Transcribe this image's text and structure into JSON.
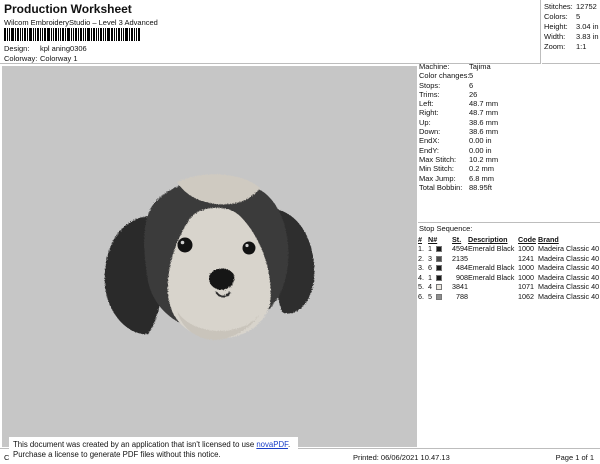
{
  "header": {
    "title": "Production Worksheet",
    "subtitle": "Wilcom EmbroideryStudio – Level 3 Advanced",
    "design_label": "Design:",
    "design_value": "kpl aning0306",
    "colorway_label": "Colorway:",
    "colorway_value": "Colorway 1"
  },
  "summary": [
    {
      "label": "Stitches:",
      "value": "12752"
    },
    {
      "label": "Colors:",
      "value": "5"
    },
    {
      "label": "Height:",
      "value": "3.04 in"
    },
    {
      "label": "Width:",
      "value": "3.83 in"
    },
    {
      "label": "Zoom:",
      "value": "1:1"
    }
  ],
  "machine_info": [
    {
      "label": "Machine:",
      "value": "Tajima"
    },
    {
      "label": "Color changes:",
      "value": "5"
    },
    {
      "label": "Stops:",
      "value": "6"
    },
    {
      "label": "Trims:",
      "value": "26"
    },
    {
      "label": "Left:",
      "value": "48.7 mm"
    },
    {
      "label": "Right:",
      "value": "48.7 mm"
    },
    {
      "label": "Up:",
      "value": "38.6 mm"
    },
    {
      "label": "Down:",
      "value": "38.6 mm"
    },
    {
      "label": "EndX:",
      "value": "0.00 in"
    },
    {
      "label": "EndY:",
      "value": "0.00 in"
    },
    {
      "label": "Max Stitch:",
      "value": "10.2 mm"
    },
    {
      "label": "Min Stitch:",
      "value": "0.2 mm"
    },
    {
      "label": "Max Jump:",
      "value": "6.8 mm"
    },
    {
      "label": "Total Bobbin:",
      "value": "88.95ft"
    }
  ],
  "stop_sequence": {
    "title": "Stop Sequence:",
    "columns": [
      "#",
      "N#",
      "St.",
      "Description",
      "Code",
      "Brand"
    ],
    "rows": [
      {
        "idx": "1.",
        "n": "1",
        "color": "#1a1a1a",
        "st": "4594",
        "desc": "Emerald Black",
        "code": "1000",
        "brand": "Madeira Classic 40"
      },
      {
        "idx": "2.",
        "n": "3",
        "color": "#4a4a4a",
        "st": "2135",
        "desc": "",
        "code": "1241",
        "brand": "Madeira Classic 40"
      },
      {
        "idx": "3.",
        "n": "6",
        "color": "#1a1a1a",
        "st": "484",
        "desc": "Emerald Black",
        "code": "1000",
        "brand": "Madeira Classic 40"
      },
      {
        "idx": "4.",
        "n": "1",
        "color": "#1a1a1a",
        "st": "908",
        "desc": "Emerald Black",
        "code": "1000",
        "brand": "Madeira Classic 40"
      },
      {
        "idx": "5.",
        "n": "4",
        "color": "#ebe7df",
        "st": "3841",
        "desc": "",
        "code": "1071",
        "brand": "Madeira Classic 40"
      },
      {
        "idx": "6.",
        "n": "5",
        "color": "#8f8f8f",
        "st": "788",
        "desc": "",
        "code": "1062",
        "brand": "Madeira Classic 40"
      }
    ]
  },
  "footer": {
    "left": "Cr",
    "printed": "Printed: 06/06/2021 10.47.13",
    "page": "Page 1 of 1"
  },
  "notice": {
    "line1_prefix": "This document was created by an application that isn't licensed to use ",
    "link": "novaPDF",
    "line1_suffix": ".",
    "line2": "Purchase a license to generate PDF files without this notice."
  }
}
